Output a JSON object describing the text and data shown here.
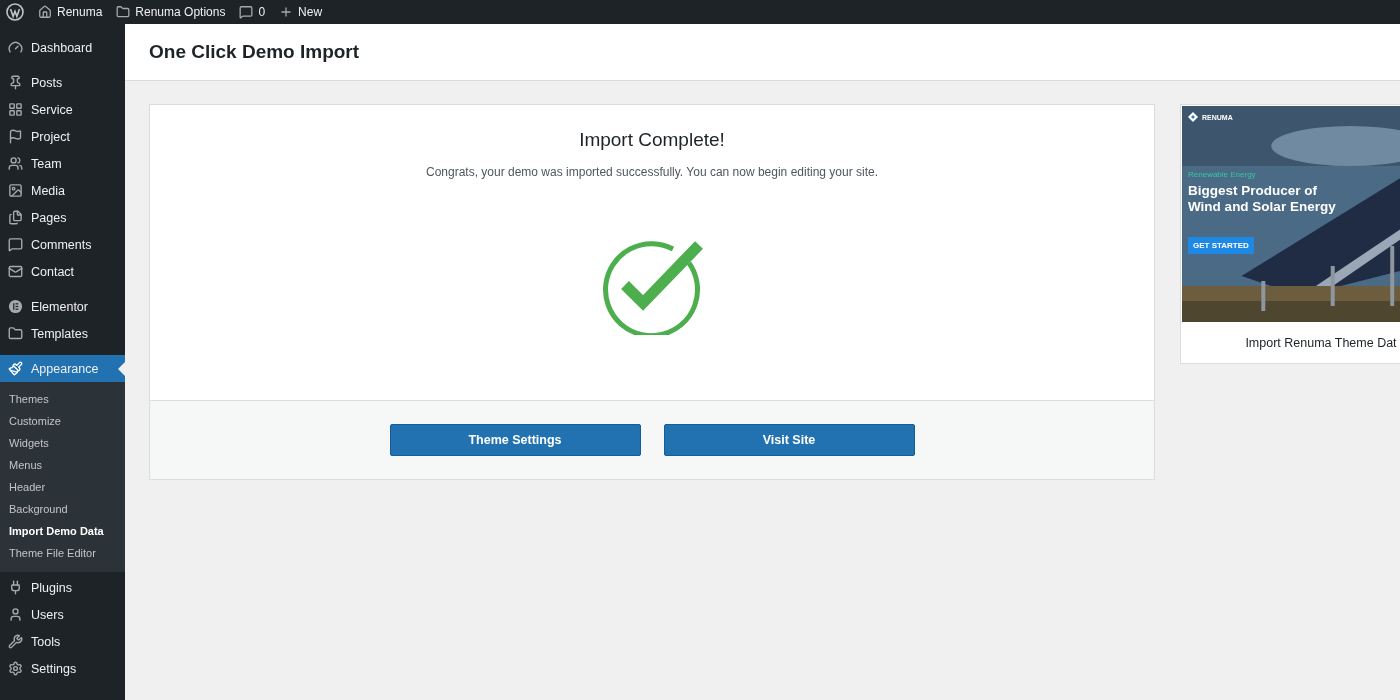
{
  "admin_bar": {
    "items": [
      {
        "kind": "home",
        "label": "Renuma"
      },
      {
        "kind": "folder",
        "label": "Renuma Options"
      },
      {
        "kind": "comment",
        "label": "0"
      },
      {
        "kind": "plus",
        "label": "New"
      }
    ]
  },
  "sidebar": {
    "groups": [
      {
        "items": [
          {
            "kind": "dashboard",
            "label": "Dashboard",
            "selected": false
          }
        ]
      },
      {
        "items": [
          {
            "kind": "pin",
            "label": "Posts",
            "selected": false
          },
          {
            "kind": "grid",
            "label": "Service",
            "selected": false
          },
          {
            "kind": "flag",
            "label": "Project",
            "selected": false
          },
          {
            "kind": "team",
            "label": "Team",
            "selected": false
          },
          {
            "kind": "media",
            "label": "Media",
            "selected": false
          },
          {
            "kind": "pages",
            "label": "Pages",
            "selected": false
          },
          {
            "kind": "comment",
            "label": "Comments",
            "selected": false
          },
          {
            "kind": "mail",
            "label": "Contact",
            "selected": false
          }
        ]
      },
      {
        "items": [
          {
            "kind": "elementor",
            "label": "Elementor",
            "selected": false
          },
          {
            "kind": "folder",
            "label": "Templates",
            "selected": false
          }
        ]
      },
      {
        "items": [
          {
            "kind": "brush",
            "label": "Appearance",
            "selected": true,
            "children": [
              {
                "label": "Themes",
                "selected": false
              },
              {
                "label": "Customize",
                "selected": false
              },
              {
                "label": "Widgets",
                "selected": false
              },
              {
                "label": "Menus",
                "selected": false
              },
              {
                "label": "Header",
                "selected": false
              },
              {
                "label": "Background",
                "selected": false
              },
              {
                "label": "Import Demo Data",
                "selected": true
              },
              {
                "label": "Theme File Editor",
                "selected": false
              }
            ]
          },
          {
            "kind": "plug",
            "label": "Plugins",
            "selected": false
          },
          {
            "kind": "user",
            "label": "Users",
            "selected": false
          },
          {
            "kind": "wrench",
            "label": "Tools",
            "selected": false
          },
          {
            "kind": "settings",
            "label": "Settings",
            "selected": false
          }
        ]
      }
    ]
  },
  "page_title": "One Click Demo Import",
  "result": {
    "title": "Import Complete!",
    "message": "Congrats, your demo was imported successfully. You can now begin editing your site.",
    "buttons": [
      "Theme Settings",
      "Visit Site"
    ]
  },
  "preview": {
    "brand": "RENUMA",
    "tagline": "Renewable Energy",
    "heading": "Biggest Producer of Wind and Solar Energy",
    "cta": "GET STARTED",
    "caption": "Import Renuma Theme Dat"
  }
}
